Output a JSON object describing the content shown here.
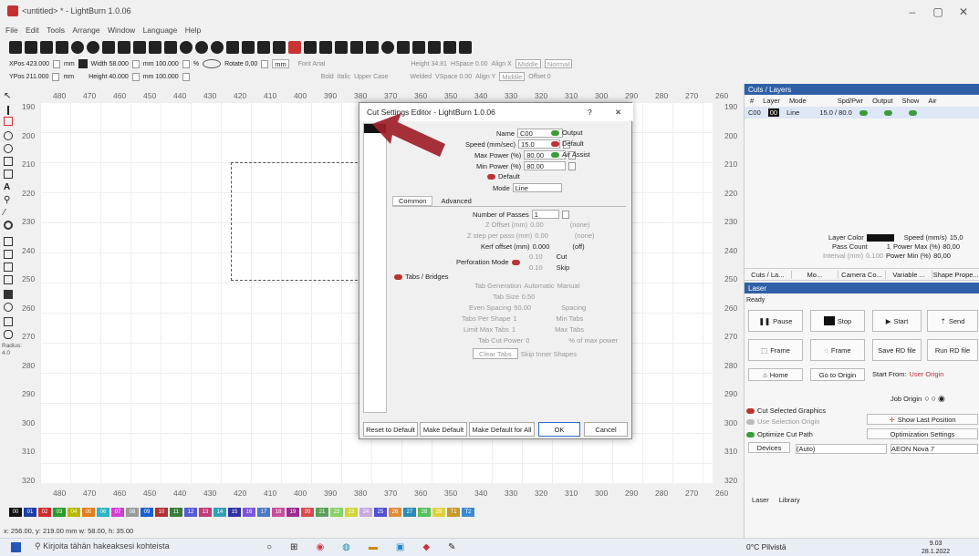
{
  "window": {
    "title": "<untitled> * - LightBurn 1.0.06",
    "min": "–",
    "max": "▢",
    "close": "✕"
  },
  "menu": [
    "File",
    "Edit",
    "Tools",
    "Arrange",
    "Window",
    "Language",
    "Help"
  ],
  "toolbar": {
    "xpos": "XPos 423.000",
    "ypos": "YPos 211.000",
    "mm1": "mm",
    "mm2": "mm",
    "width": "Width 58.000",
    "height": "Height 40.000",
    "pct1": "mm  100.000",
    "pct2": "mm  100.000",
    "pct": "%",
    "rotate": "Rotate 0,00",
    "mmbtn": "mm",
    "font": "Font Arial",
    "fheight": "Height 34.81",
    "hspace": "HSpace 0.00",
    "alignx": "Align X",
    "alignx_val": "Middle",
    "normal": "Normal",
    "bold": "Bold",
    "italic": "Italic",
    "upper": "Upper Case",
    "welded": "Welded",
    "vspace": "VSpace 0.00",
    "aligny": "Align Y",
    "aligny_val": "Middle",
    "offset": "Offset 0"
  },
  "ruler_h": [
    "480",
    "470",
    "460",
    "450",
    "440",
    "430",
    "420",
    "410",
    "400",
    "390",
    "380",
    "370",
    "360",
    "350",
    "340",
    "330",
    "320",
    "310",
    "300",
    "290",
    "280",
    "270",
    "260"
  ],
  "ruler_v": [
    "190",
    "200",
    "210",
    "220",
    "230",
    "240",
    "250",
    "260",
    "270",
    "280",
    "290",
    "300",
    "310",
    "320"
  ],
  "left_radius": "Radius:",
  "left_radius_val": "4.0",
  "palette": [
    {
      "l": "00",
      "c": "#111111"
    },
    {
      "l": "01",
      "c": "#1b3fa6"
    },
    {
      "l": "02",
      "c": "#d32b2b"
    },
    {
      "l": "03",
      "c": "#2a9a2a"
    },
    {
      "l": "04",
      "c": "#b8b800"
    },
    {
      "l": "05",
      "c": "#e07e1c"
    },
    {
      "l": "06",
      "c": "#2bb3c2"
    },
    {
      "l": "07",
      "c": "#d43cd4"
    },
    {
      "l": "08",
      "c": "#9a9a9a"
    },
    {
      "l": "09",
      "c": "#1a5fd0"
    },
    {
      "l": "10",
      "c": "#b13030"
    },
    {
      "l": "11",
      "c": "#3a7c3a"
    },
    {
      "l": "12",
      "c": "#5a5ad8"
    },
    {
      "l": "13",
      "c": "#c23a7a"
    },
    {
      "l": "14",
      "c": "#2fa0b8"
    },
    {
      "l": "15",
      "c": "#3030a0"
    },
    {
      "l": "16",
      "c": "#7e56d8"
    },
    {
      "l": "17",
      "c": "#4c78c4"
    },
    {
      "l": "18",
      "c": "#c84d9a"
    },
    {
      "l": "19",
      "c": "#9c2c8c"
    },
    {
      "l": "20",
      "c": "#d84c4c"
    },
    {
      "l": "21",
      "c": "#5aa05a"
    },
    {
      "l": "22",
      "c": "#8ad06a"
    },
    {
      "l": "23",
      "c": "#d4d43c"
    },
    {
      "l": "24",
      "c": "#c8a8e0"
    },
    {
      "l": "25",
      "c": "#5050d0"
    },
    {
      "l": "26",
      "c": "#e08a3c"
    },
    {
      "l": "27",
      "c": "#2a8ab8"
    },
    {
      "l": "28",
      "c": "#58c058"
    },
    {
      "l": "29",
      "c": "#e0d03c"
    },
    {
      "l": "T1",
      "c": "#c89a2a"
    },
    {
      "l": "T2",
      "c": "#3a8ad4"
    }
  ],
  "status": "x: 256.00, y: 219.00 mm  w: 58.00,  h: 35.00",
  "taskbar": {
    "search": "Kirjoita tähän hakeaksesi kohteista",
    "weather": "0°C  Pilvistä",
    "time": "9.03",
    "date": "28.1.2022"
  },
  "cuts": {
    "title": "Cuts / Layers",
    "cols": [
      "#",
      "Layer",
      "Mode",
      "Spd/Pwr",
      "Output",
      "Show",
      "Air"
    ],
    "row": {
      "num": "C00",
      "layer": "00",
      "mode": "Line",
      "spd": "15.0 / 80.0"
    },
    "layer_color": "Layer Color",
    "speed": "Speed (mm/s)",
    "speed_val": "15,0",
    "pass": "Pass Count",
    "pass_val": "1",
    "pmax": "Power Max (%)",
    "pmax_val": "80,00",
    "interval": "Interval (mm)",
    "interval_val": "0.100",
    "pmin": "Power Min (%)",
    "pmin_val": "80,00",
    "tabs": [
      "Cuts / La...",
      "Mo...",
      "Camera Co...",
      "Variable ...",
      "Shape Prope..."
    ]
  },
  "laser": {
    "title": "Laser",
    "ready": "Ready",
    "pause": "Pause",
    "stop": "Stop",
    "start": "Start",
    "send": "Send",
    "frame1": "Frame",
    "frame2": "Frame",
    "save": "Save RD file",
    "run": "Run RD file",
    "home": "Home",
    "origin": "Go to Origin",
    "startfrom": "Start From:",
    "startfrom_val": "User Origin",
    "joborigin": "Job Origin",
    "cutsel": "Cut Selected Graphics",
    "usesel": "Use Selection Origin",
    "showlast": "Show Last Position",
    "optimize": "Optimize Cut Path",
    "optset": "Optimization Settings",
    "devices": "Devices",
    "auto": "(Auto)",
    "device": "AEON Nova 7",
    "tabs": [
      "Laser",
      "Library"
    ]
  },
  "dialog": {
    "title": "Cut Settings Editor - LightBurn 1.0.06",
    "help": "?",
    "close": "✕",
    "name": "Name",
    "name_val": "C00",
    "output": "Output",
    "speed": "Speed (mm/sec)",
    "speed_val": "15.0",
    "default": "Default",
    "maxp": "Max Power (%)",
    "maxp_val": "80.00",
    "air": "Air Assist",
    "minp": "Min Power (%)",
    "minp_val": "80.00",
    "default2": "Default",
    "mode": "Mode",
    "mode_val": "Line",
    "tab_common": "Common",
    "tab_adv": "Advanced",
    "passes": "Number of Passes",
    "passes_val": "1",
    "zoff": "Z Offset (mm)",
    "zoff_val": "0.00",
    "none1": "(none)",
    "zstep": "Z step per pass (mm)",
    "zstep_val": "0.00",
    "none2": "(none)",
    "kerf": "Kerf offset (mm)",
    "kerf_val": "0.000",
    "off": "(off)",
    "perf": "Perforation Mode",
    "perf_v1": "0.10",
    "perf_v2": "0.10",
    "cut": "Cut",
    "skip": "Skip",
    "tabs": "Tabs / Bridges",
    "tabgen": "Tab Generation",
    "auto": "Automatic",
    "manual": "Manual",
    "tabsize": "Tab Size",
    "tabsize_val": "0.50",
    "even": "Even Spacing",
    "even_val": "50.00",
    "spacing": "Spacing",
    "tps": "Tabs Per Shape",
    "tps_val": "1",
    "mintabs": "Min Tabs",
    "limit": "Limit Max Tabs",
    "limit_val": "1",
    "maxtabs": "Max Tabs",
    "tabcut": "Tab Cut Power",
    "tabcut_val": "0",
    "pctmax": "% of max power",
    "clear": "Clear Tabs",
    "skipinner": "Skip Inner Shapes",
    "reset": "Reset to Default",
    "makedef": "Make Default",
    "makedefall": "Make Default for All",
    "ok": "OK",
    "cancel": "Cancel"
  }
}
